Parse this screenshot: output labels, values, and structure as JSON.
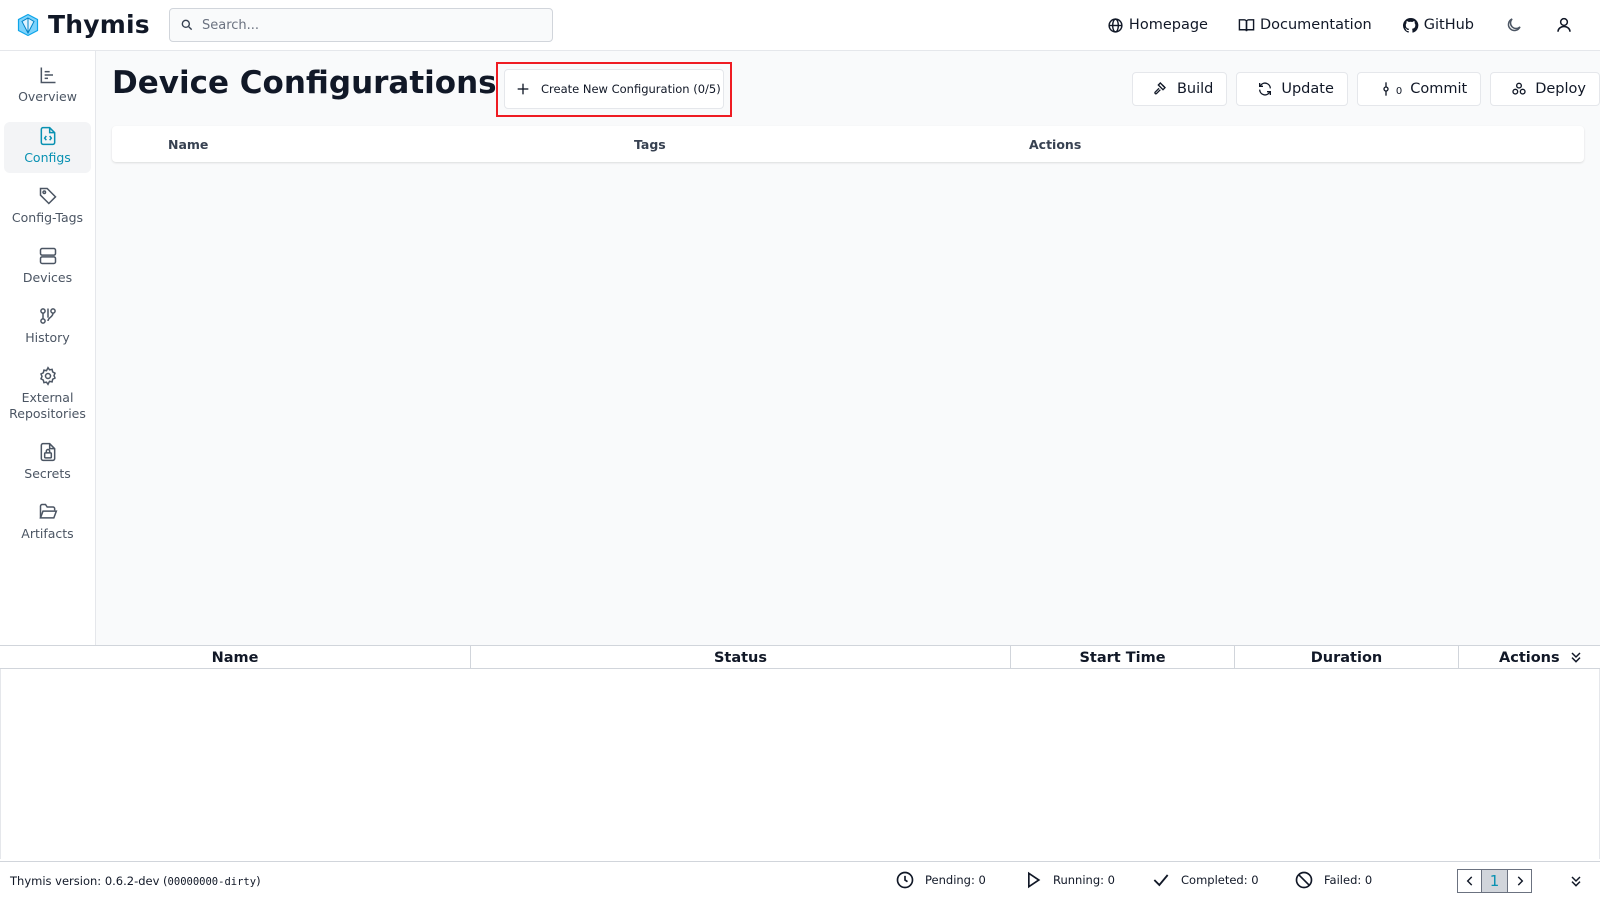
{
  "header": {
    "app_name": "Thymis",
    "search_placeholder": "Search...",
    "links": {
      "homepage": "Homepage",
      "documentation": "Documentation",
      "github": "GitHub"
    },
    "icons": [
      "globe-icon",
      "book-icon",
      "github-icon",
      "moon-icon",
      "user-icon"
    ]
  },
  "sidebar": {
    "items": [
      {
        "label": "Overview",
        "icon": "chart-icon",
        "active": false
      },
      {
        "label": "Configs",
        "icon": "file-code-icon",
        "active": true
      },
      {
        "label": "Config-Tags",
        "icon": "tag-icon",
        "active": false
      },
      {
        "label": "Devices",
        "icon": "server-icon",
        "active": false
      },
      {
        "label": "History",
        "icon": "git-branch-icon",
        "active": false
      },
      {
        "label": "External Repositories",
        "icon": "gear-icon",
        "active": false
      },
      {
        "label": "Secrets",
        "icon": "file-lock-icon",
        "active": false
      },
      {
        "label": "Artifacts",
        "icon": "folder-open-icon",
        "active": false
      }
    ]
  },
  "main": {
    "title": "Device Configurations",
    "create_button": "Create New Configuration (0/5)",
    "actions": {
      "build": "Build",
      "update": "Update",
      "commit_count": "0",
      "commit": "Commit",
      "deploy": "Deploy"
    },
    "table_headers": {
      "name": "Name",
      "tags": "Tags",
      "actions": "Actions"
    }
  },
  "tasks": {
    "headers": {
      "name": "Name",
      "status": "Status",
      "start_time": "Start Time",
      "duration": "Duration",
      "actions": "Actions"
    }
  },
  "statusbar": {
    "version_prefix": "Thymis version: 0.6.2-dev (",
    "version_hash": "00000000-dirty",
    "version_suffix": ")",
    "pending": "Pending: 0",
    "running": "Running: 0",
    "completed": "Completed: 0",
    "failed": "Failed: 0",
    "current_page": "1"
  },
  "colors": {
    "accent": "#0891b2",
    "highlight_border": "#ef1c23",
    "logo": "#38bdf8"
  }
}
